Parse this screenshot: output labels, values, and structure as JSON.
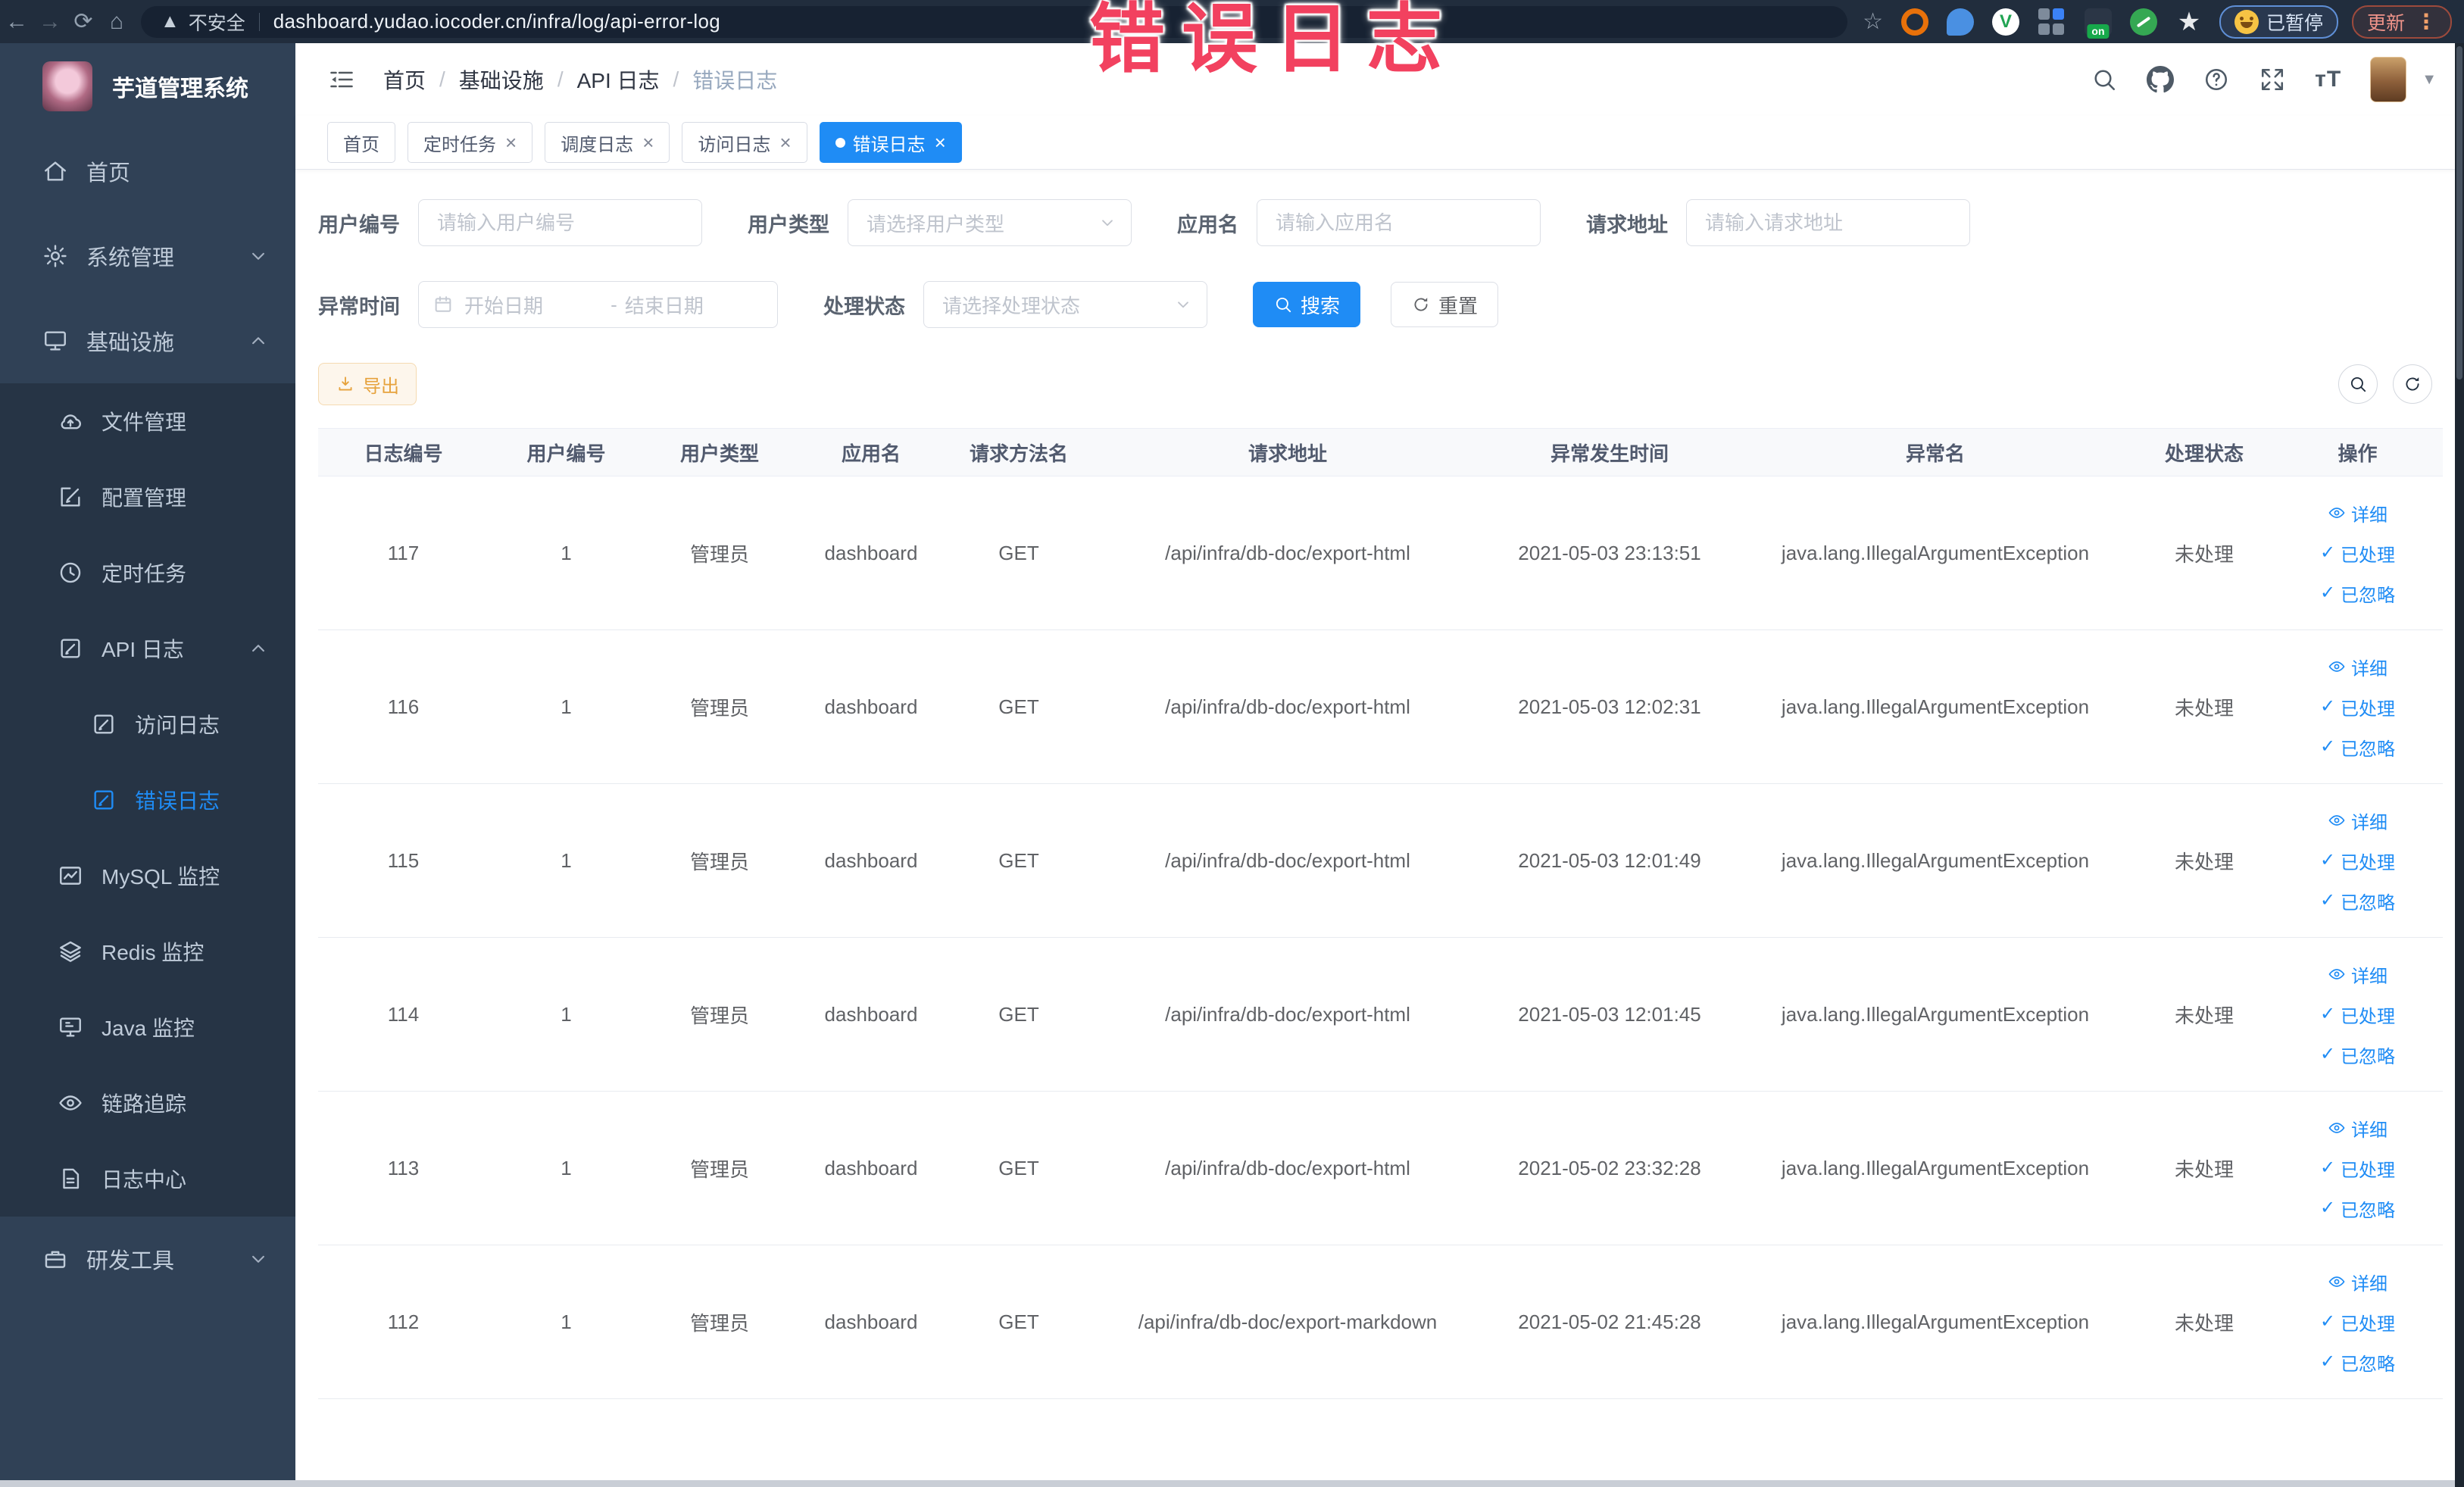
{
  "colors": {
    "accent": "#1F8CF5",
    "warning": "#E6A23C",
    "overlay_red": "#F2415F",
    "sidebar_bg": "#304156",
    "submenu_bg": "#263445"
  },
  "overlay": {
    "text": "错误日志"
  },
  "browser": {
    "security_label": "不安全",
    "url": "dashboard.yudao.iocoder.cn/infra/log/api-error-log",
    "extension_on_badge": "on",
    "paused_label": "已暂停",
    "update_label": "更新"
  },
  "app": {
    "title": "芋道管理系统",
    "breadcrumb": [
      "首页",
      "基础设施",
      "API 日志",
      "错误日志"
    ]
  },
  "sidebar": {
    "items": [
      {
        "label": "首页",
        "icon": "home",
        "level": 1
      },
      {
        "label": "系统管理",
        "icon": "gear",
        "level": 1,
        "chevron": "down"
      },
      {
        "label": "基础设施",
        "icon": "infra",
        "level": 1,
        "chevron": "up"
      },
      {
        "label": "文件管理",
        "icon": "cloud",
        "level": 2,
        "sub": true
      },
      {
        "label": "配置管理",
        "icon": "edit",
        "level": 2,
        "sub": true
      },
      {
        "label": "定时任务",
        "icon": "clock",
        "level": 2,
        "sub": true
      },
      {
        "label": "API 日志",
        "icon": "log",
        "level": 2,
        "sub": true,
        "chevron": "up"
      },
      {
        "label": "访问日志",
        "icon": "log",
        "level": 3,
        "sub": true
      },
      {
        "label": "错误日志",
        "icon": "log",
        "level": 3,
        "sub": true,
        "active": true
      },
      {
        "label": "MySQL 监控",
        "icon": "chart",
        "level": 2,
        "sub": true
      },
      {
        "label": "Redis 监控",
        "icon": "layers",
        "level": 2,
        "sub": true
      },
      {
        "label": "Java 监控",
        "icon": "display",
        "level": 2,
        "sub": true
      },
      {
        "label": "链路追踪",
        "icon": "eye",
        "level": 2,
        "sub": true
      },
      {
        "label": "日志中心",
        "icon": "doc",
        "level": 2,
        "sub": true
      },
      {
        "label": "研发工具",
        "icon": "tool",
        "level": 1,
        "chevron": "down"
      }
    ]
  },
  "tabs": [
    {
      "label": "首页",
      "closable": false,
      "active": false
    },
    {
      "label": "定时任务",
      "closable": true,
      "active": false
    },
    {
      "label": "调度日志",
      "closable": true,
      "active": false
    },
    {
      "label": "访问日志",
      "closable": true,
      "active": false
    },
    {
      "label": "错误日志",
      "closable": true,
      "active": true
    }
  ],
  "filters": {
    "user_id": {
      "label": "用户编号",
      "placeholder": "请输入用户编号"
    },
    "user_type": {
      "label": "用户类型",
      "placeholder": "请选择用户类型"
    },
    "app_name": {
      "label": "应用名",
      "placeholder": "请输入应用名"
    },
    "request_url": {
      "label": "请求地址",
      "placeholder": "请输入请求地址"
    },
    "exception_time": {
      "label": "异常时间",
      "start_placeholder": "开始日期",
      "separator": "-",
      "end_placeholder": "结束日期"
    },
    "process_status": {
      "label": "处理状态",
      "placeholder": "请选择处理状态"
    },
    "search_label": "搜索",
    "reset_label": "重置"
  },
  "toolbar": {
    "export_label": "导出"
  },
  "table": {
    "headers": [
      "日志编号",
      "用户编号",
      "用户类型",
      "应用名",
      "请求方法名",
      "请求地址",
      "异常发生时间",
      "异常名",
      "处理状态",
      "操作"
    ],
    "actions": [
      "详细",
      "已处理",
      "已忽略"
    ],
    "rows": [
      {
        "id": "117",
        "user_id": "1",
        "user_type": "管理员",
        "app": "dashboard",
        "method": "GET",
        "url": "/api/infra/db-doc/export-html",
        "time": "2021-05-03 23:13:51",
        "exception": "java.lang.IllegalArgumentException",
        "status": "未处理"
      },
      {
        "id": "116",
        "user_id": "1",
        "user_type": "管理员",
        "app": "dashboard",
        "method": "GET",
        "url": "/api/infra/db-doc/export-html",
        "time": "2021-05-03 12:02:31",
        "exception": "java.lang.IllegalArgumentException",
        "status": "未处理"
      },
      {
        "id": "115",
        "user_id": "1",
        "user_type": "管理员",
        "app": "dashboard",
        "method": "GET",
        "url": "/api/infra/db-doc/export-html",
        "time": "2021-05-03 12:01:49",
        "exception": "java.lang.IllegalArgumentException",
        "status": "未处理"
      },
      {
        "id": "114",
        "user_id": "1",
        "user_type": "管理员",
        "app": "dashboard",
        "method": "GET",
        "url": "/api/infra/db-doc/export-html",
        "time": "2021-05-03 12:01:45",
        "exception": "java.lang.IllegalArgumentException",
        "status": "未处理"
      },
      {
        "id": "113",
        "user_id": "1",
        "user_type": "管理员",
        "app": "dashboard",
        "method": "GET",
        "url": "/api/infra/db-doc/export-html",
        "time": "2021-05-02 23:32:28",
        "exception": "java.lang.IllegalArgumentException",
        "status": "未处理"
      },
      {
        "id": "112",
        "user_id": "1",
        "user_type": "管理员",
        "app": "dashboard",
        "method": "GET",
        "url": "/api/infra/db-doc/export-markdown",
        "time": "2021-05-02 21:45:28",
        "exception": "java.lang.IllegalArgumentException",
        "status": "未处理"
      }
    ]
  }
}
